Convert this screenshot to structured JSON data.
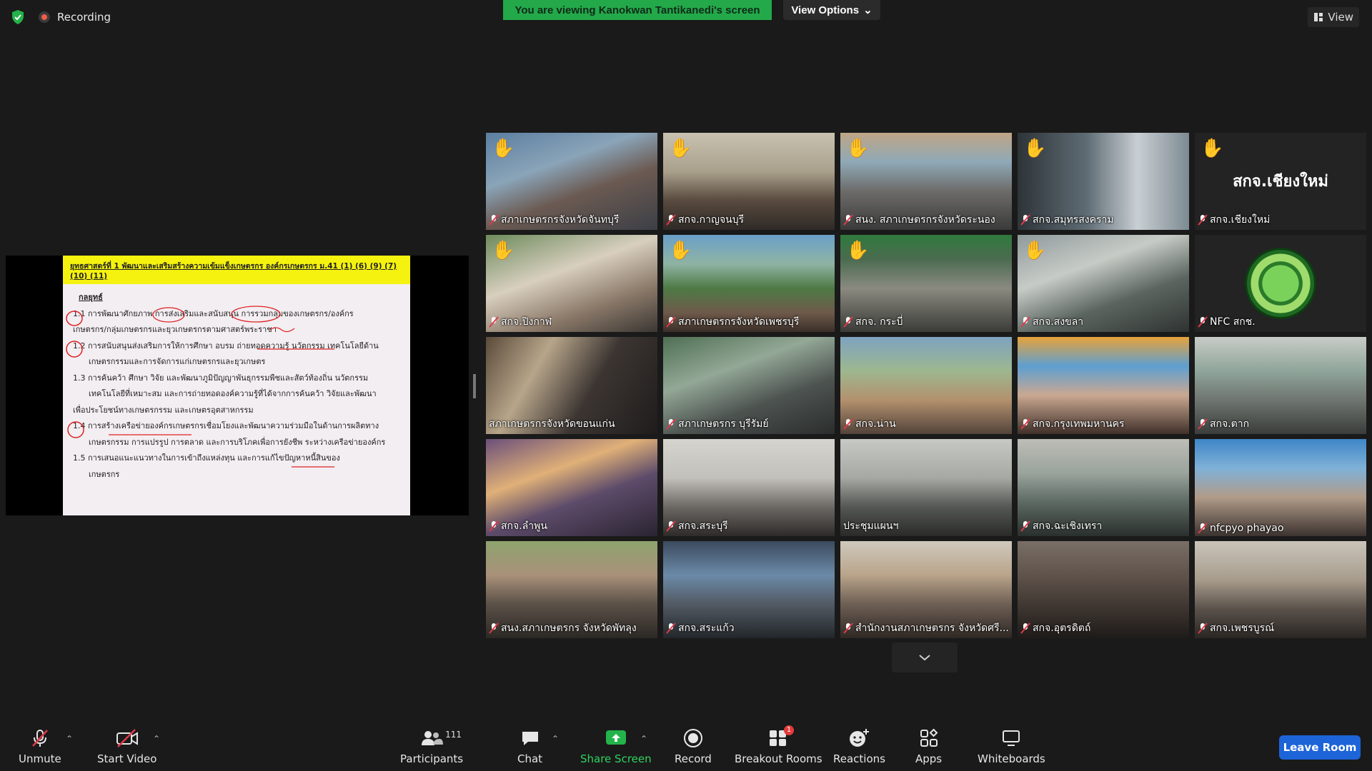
{
  "top": {
    "recording_label": "Recording",
    "viewing_banner": "You are viewing Kanokwan Tantikanedi's screen",
    "view_options_label": "View Options",
    "view_label": "View"
  },
  "shared_document": {
    "header": "ยุทธศาสตร์ที่ 1 พัฒนาและเสริมสร้างความเข้มแข็งเกษตรกร องค์กรเกษตรกร ม.41 (1) (6) (9) (7) (10) (11)",
    "heading": "กลยุทธ์",
    "lines": [
      "1.1 การพัฒนาศักยภาพ การส่งเสริมและสนับสนุน การรวมกลุ่มของเกษตรกร/องค์กร",
      "เกษตรกร/กลุ่มเกษตรกรและยุวเกษตรกรตามศาสตร์พระราชา",
      "1.2 การสนับสนุนส่งเสริมการให้การศึกษา อบรม ถ่ายทอดความรู้ นวัตกรรม เทคโนโลยีด้าน",
      "เกษตรกรรมและการจัดการแก่เกษตรกรและยุวเกษตร",
      "1.3 การค้นคว้า ศึกษา วิจัย และพัฒนาภูมิปัญญาพันธุกรรมพืชและสัตว์ท้องถิ่น นวัตกรรม",
      "เทคโนโลยีที่เหมาะสม และการถ่ายทอดองค์ความรู้ที่ได้จากการค้นคว้า วิจัยและพัฒนา",
      "เพื่อประโยชน์ทางเกษตรกรรม และเกษตรอุตสาหกรรม",
      "1.4 การสร้างเครือข่ายองค์กรเกษตรกรเชื่อมโยงและพัฒนาความร่วมมือในด้านการผลิตทาง",
      "เกษตรกรรม การแปรรูป การตลาด และการบริโภคเพื่อการยังชีพ ระหว่างเครือข่ายองค์กร",
      "1.5 การเสนอแนะแนวทางในการเข้าถึงแหล่งทุน และการแก้ไขปัญหาหนี้สินของ",
      "เกษตรกร"
    ]
  },
  "participants_grid": [
    {
      "name": "สภาเกษตรกรจังหวัดจันทบุรี",
      "hand_raised": true,
      "muted": true
    },
    {
      "name": "สกจ.กาญจนบุรี",
      "hand_raised": true,
      "muted": true
    },
    {
      "name": "สนง. สภาเกษตรกรจังหวัดระนอง",
      "hand_raised": true,
      "muted": true
    },
    {
      "name": "สกจ.สมุทรสงคราม",
      "hand_raised": true,
      "muted": true
    },
    {
      "name": "สกจ.เชียงใหม่",
      "hand_raised": true,
      "muted": true,
      "video_off_text": "สกจ.เชียงใหม่"
    },
    {
      "name": "สกจ.ปิงกาฬ",
      "hand_raised": true,
      "muted": true
    },
    {
      "name": "สภาเกษตรกรจังหวัดเพชรบุรี",
      "hand_raised": true,
      "muted": true
    },
    {
      "name": "สกจ. กระบี่",
      "hand_raised": true,
      "muted": true
    },
    {
      "name": "สกจ.สงขลา",
      "hand_raised": true,
      "muted": true
    },
    {
      "name": "NFC สกช.",
      "hand_raised": false,
      "muted": true
    },
    {
      "name": "สภาเกษตรกรจังหวัดขอนแก่น",
      "hand_raised": false,
      "muted": false,
      "active_speaker": true
    },
    {
      "name": "สภาเกษตรกร บุรีรัมย์",
      "hand_raised": false,
      "muted": true
    },
    {
      "name": "สกจ.น่าน",
      "hand_raised": false,
      "muted": true
    },
    {
      "name": "สกจ.กรุงเทพมหานคร",
      "hand_raised": false,
      "muted": true
    },
    {
      "name": "สกจ.ตาก",
      "hand_raised": false,
      "muted": true
    },
    {
      "name": "สกจ.ลำพูน",
      "hand_raised": false,
      "muted": true
    },
    {
      "name": "สกจ.สระบุรี",
      "hand_raised": false,
      "muted": true
    },
    {
      "name": "ประชุมแผนฯ",
      "hand_raised": false,
      "muted": false
    },
    {
      "name": "สกจ.ฉะเชิงเทรา",
      "hand_raised": false,
      "muted": true
    },
    {
      "name": "nfcpyo phayao",
      "hand_raised": false,
      "muted": true
    },
    {
      "name": "สนง.สภาเกษตรกร จังหวัดพัทลุง",
      "hand_raised": false,
      "muted": true
    },
    {
      "name": "สกจ.สระแก้ว",
      "hand_raised": false,
      "muted": true
    },
    {
      "name": "สำนักงานสภาเกษตรกร จังหวัดศรี...",
      "hand_raised": false,
      "muted": true
    },
    {
      "name": "สกจ.อุตรดิตถ์",
      "hand_raised": false,
      "muted": true
    },
    {
      "name": "สกจ.เพชรบูรณ์",
      "hand_raised": false,
      "muted": true
    }
  ],
  "toolbar": {
    "unmute_label": "Unmute",
    "start_video_label": "Start Video",
    "participants_label": "Participants",
    "participants_count": "111",
    "chat_label": "Chat",
    "share_screen_label": "Share Screen",
    "record_label": "Record",
    "breakout_rooms_label": "Breakout Rooms",
    "breakout_badge": "1",
    "reactions_label": "Reactions",
    "apps_label": "Apps",
    "whiteboards_label": "Whiteboards",
    "leave_label": "Leave Room"
  },
  "colors": {
    "banner_green": "#23a94a",
    "leave_blue": "#1d64d8",
    "active_outline": "#e8e070",
    "muted_red": "#e0394a"
  }
}
